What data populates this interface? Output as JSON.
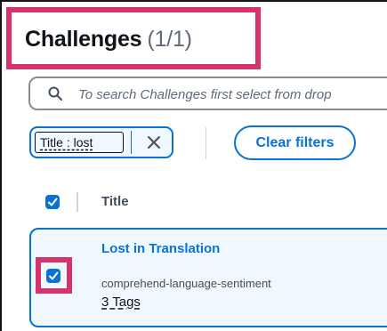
{
  "header": {
    "title": "Challenges",
    "count": "(1/1)"
  },
  "search": {
    "placeholder": "To search Challenges first select from drop"
  },
  "filter": {
    "chip_label": "Title : lost",
    "clear_label": "Clear filters"
  },
  "table": {
    "column_title": "Title",
    "rows": [
      {
        "title": "Lost in Translation",
        "subtitle": "comprehend-language-sentiment",
        "tags": "3 Tags",
        "selected": true
      }
    ]
  },
  "colors": {
    "accent": "#0972d3",
    "highlight": "#d6336c",
    "selected_bg": "#f0f8ff"
  },
  "icons": [
    "search-icon",
    "close-icon",
    "checkbox-checked-icon"
  ]
}
